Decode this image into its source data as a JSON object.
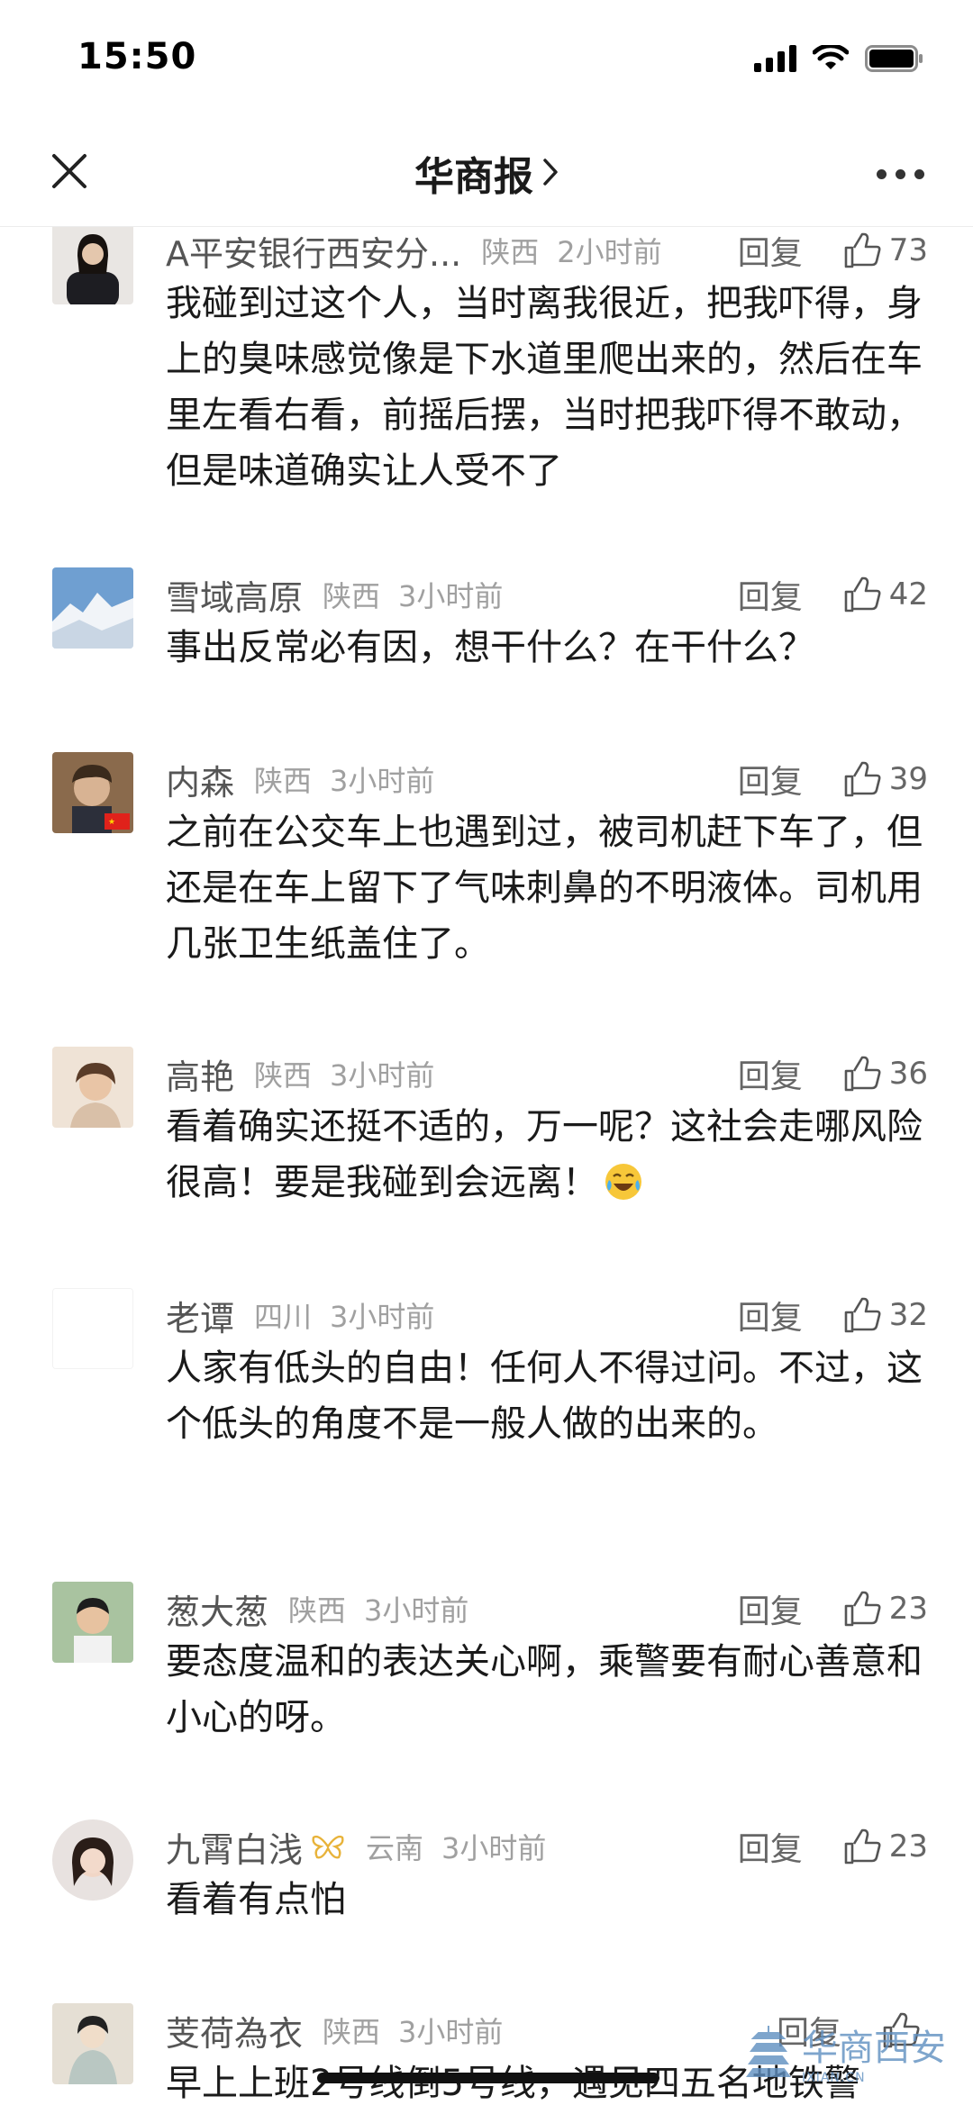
{
  "status_bar": {
    "time": "15:50"
  },
  "nav": {
    "title": "华商报"
  },
  "comments": [
    {
      "name": "A平安银行西安分...",
      "location": "陕西",
      "time": "2小时前",
      "reply": "回复",
      "likes": "73",
      "text": "我碰到过这个人，当时离我很近，把我吓得，身上的臭味感觉像是下水道里爬出来的，然后在车里左看右看，前摇后摆，当时把我吓得不敢动，但是味道确实让人受不了"
    },
    {
      "name": "雪域高原",
      "location": "陕西",
      "time": "3小时前",
      "reply": "回复",
      "likes": "42",
      "text": "事出反常必有因，想干什么？在干什么？"
    },
    {
      "name": "内森",
      "location": "陕西",
      "time": "3小时前",
      "reply": "回复",
      "likes": "39",
      "text": "之前在公交车上也遇到过，被司机赶下车了，但还是在车上留下了气味刺鼻的不明液体。司机用几张卫生纸盖住了。"
    },
    {
      "name": "高艳",
      "location": "陕西",
      "time": "3小时前",
      "reply": "回复",
      "likes": "36",
      "text": "看着确实还挺不适的，万一呢？这社会走哪风险很高！要是我碰到会远离！"
    },
    {
      "name": "老谭",
      "location": "四川",
      "time": "3小时前",
      "reply": "回复",
      "likes": "32",
      "text": "人家有低头的自由！任何人不得过问。不过，这个低头的角度不是一般人做的出来的。"
    },
    {
      "name": "葱大葱",
      "location": "陕西",
      "time": "3小时前",
      "reply": "回复",
      "likes": "23",
      "text": "要态度温和的表达关心啊，乘警要有耐心善意和小心的呀。"
    },
    {
      "name": "九霄白浅",
      "location": "云南",
      "time": "3小时前",
      "reply": "回复",
      "likes": "23",
      "text": "看着有点怕"
    },
    {
      "name": "芰荷為衣",
      "location": "陕西",
      "time": "3小时前",
      "reply": "回复",
      "likes": "",
      "text": "早上上班2号线倒5号线，遇见四五名地铁警"
    }
  ],
  "watermark": {
    "text": "华商西安",
    "sub": "IXIAN.CN"
  },
  "icons": {
    "close": "close-icon",
    "chevron": "chevron-right-icon",
    "more": "more-icon",
    "like": "thumbs-up-icon",
    "emoji": "laughing-tears-emoji-icon",
    "flag": "china-flag-icon",
    "vip": "butterfly-vip-icon"
  }
}
